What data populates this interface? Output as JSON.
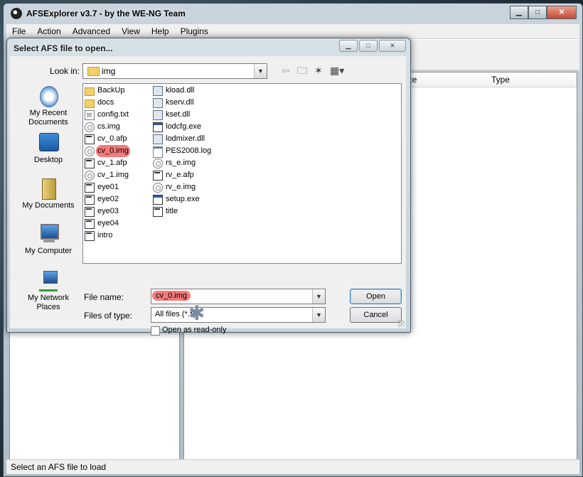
{
  "main": {
    "title": "AFSExplorer v3.7  - by the WE-NG Team",
    "menu": [
      "File",
      "Action",
      "Advanced",
      "View",
      "Help",
      "Plugins"
    ],
    "columns": {
      "size": "ize",
      "type": "Type"
    },
    "status": "Select an AFS file to load",
    "window_buttons": [
      "minimize-icon",
      "maximize-icon",
      "close-icon"
    ]
  },
  "dialog": {
    "title": "Select AFS file to open...",
    "look_in_label": "Look in:",
    "look_in_value": "img",
    "places": [
      {
        "line1": "My Recent",
        "line2": "Documents",
        "icon": "recent-documents-icon"
      },
      {
        "line1": "Desktop",
        "line2": "",
        "icon": "desktop-icon"
      },
      {
        "line1": "My Documents",
        "line2": "",
        "icon": "my-documents-icon"
      },
      {
        "line1": "My Computer",
        "line2": "",
        "icon": "my-computer-icon"
      },
      {
        "line1": "My Network",
        "line2": "Places",
        "icon": "network-places-icon"
      }
    ],
    "files_col1": [
      {
        "name": "BackUp",
        "kind": "folder"
      },
      {
        "name": "docs",
        "kind": "folder"
      },
      {
        "name": "config.txt",
        "kind": "doc"
      },
      {
        "name": "cs.img",
        "kind": "img"
      },
      {
        "name": "cv_0.afp",
        "kind": "afp"
      },
      {
        "name": "cv_0.img",
        "kind": "img",
        "highlight": true
      },
      {
        "name": "cv_1.afp",
        "kind": "afp"
      },
      {
        "name": "cv_1.img",
        "kind": "img"
      },
      {
        "name": "eye01",
        "kind": "afp"
      },
      {
        "name": "eye02",
        "kind": "afp"
      },
      {
        "name": "eye03",
        "kind": "afp"
      },
      {
        "name": "eye04",
        "kind": "afp"
      },
      {
        "name": "intro",
        "kind": "afp"
      }
    ],
    "files_col2": [
      {
        "name": "kload.dll",
        "kind": "dll"
      },
      {
        "name": "kserv.dll",
        "kind": "dll"
      },
      {
        "name": "kset.dll",
        "kind": "dll"
      },
      {
        "name": "lodcfg.exe",
        "kind": "exe"
      },
      {
        "name": "lodmixer.dll",
        "kind": "dll"
      },
      {
        "name": "PES2008.log",
        "kind": "log"
      },
      {
        "name": "rs_e.img",
        "kind": "img"
      },
      {
        "name": "rv_e.afp",
        "kind": "afp"
      },
      {
        "name": "rv_e.img",
        "kind": "img"
      },
      {
        "name": "setup.exe",
        "kind": "exe"
      },
      {
        "name": "title",
        "kind": "afp"
      }
    ],
    "file_name_label": "File name:",
    "file_name_value": "cv_0.img",
    "files_of_type_label": "Files of type:",
    "files_of_type_value": "All files (*.*)",
    "read_only_label": "Open as read-only",
    "open_label": "Open",
    "cancel_label": "Cancel"
  }
}
